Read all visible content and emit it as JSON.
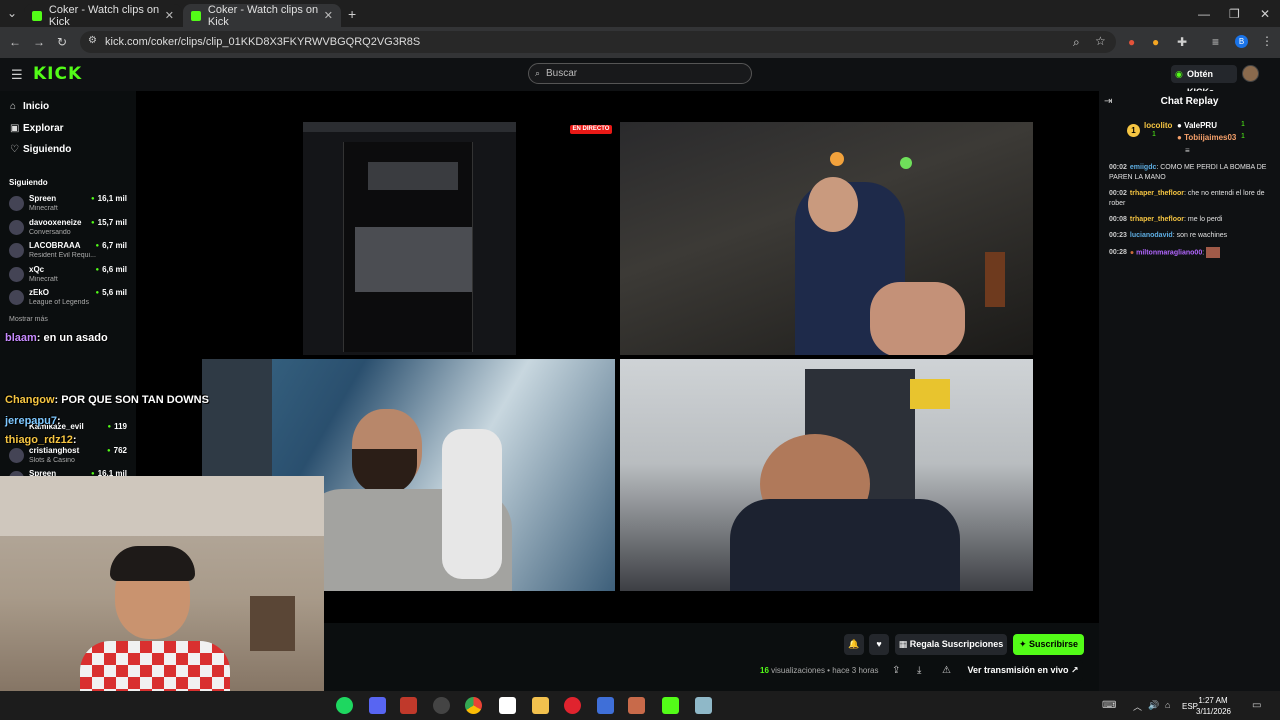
{
  "browser": {
    "tabs": [
      {
        "title": "Coker - Watch clips on Kick"
      },
      {
        "title": "Coker - Watch clips on Kick"
      }
    ],
    "url": "kick.com/coker/clips/clip_01KKD8X3FKYRWVBGQRQ2VG3R8S"
  },
  "kick": {
    "logo": "KICK",
    "search_placeholder": "Buscar",
    "get_kicks_label": "Obtén KICKs"
  },
  "sidebar": {
    "nav": [
      {
        "label": "Inicio",
        "icon": "home-icon"
      },
      {
        "label": "Explorar",
        "icon": "compass-icon"
      },
      {
        "label": "Siguiendo",
        "icon": "heart-icon"
      }
    ],
    "following_header": "Siguiendo",
    "following": [
      {
        "name": "Spreen",
        "category": "Minecraft",
        "viewers": "16,1 mil"
      },
      {
        "name": "davooxeneize",
        "category": "Conversando",
        "viewers": "15,7 mil"
      },
      {
        "name": "LACOBRAAA",
        "category": "Resident Evil Requi...",
        "viewers": "6,7 mil"
      },
      {
        "name": "xQc",
        "category": "Minecraft",
        "viewers": "6,6 mil"
      },
      {
        "name": "zEkO",
        "category": "League of Legends",
        "viewers": "5,6 mil"
      }
    ],
    "show_more": "Mostrar más",
    "recommended": [
      {
        "name": "Kamikaze_evil",
        "category": "",
        "viewers": "119"
      },
      {
        "name": "cristianghost",
        "category": "Slots & Casino",
        "viewers": "762"
      },
      {
        "name": "Spreen",
        "category": "",
        "viewers": "16,1 mil"
      }
    ]
  },
  "overlay_chat": [
    {
      "user": "blaam",
      "text": ": en un asado"
    },
    {
      "user": "Changow",
      "text": ": POR QUE SON TAN DOWNS"
    },
    {
      "user": "jerepapu7",
      "text": ":"
    },
    {
      "user": "thiago_rdz12",
      "text": ":"
    }
  ],
  "stream": {
    "live_badge": "EN DIRECTO"
  },
  "actions": {
    "gift_label": "Regala Suscripciones",
    "subscribe_label": "Suscribirse",
    "views_count": "16",
    "views_label": "visualizaciones",
    "time_ago": "hace 3 horas",
    "watch_live_label": "Ver transmisión en vivo"
  },
  "chat": {
    "title": "Chat Replay",
    "top_gifters": [
      {
        "name": "locolito",
        "count": "1"
      },
      {
        "name": "ValePRU",
        "count": "1"
      },
      {
        "name": "Tobiijaimes03",
        "count": "1"
      }
    ],
    "messages": [
      {
        "time": "00:02",
        "user": "emiigdc",
        "text": "COMO ME PERDI LA BOMBA DE PAREN LA MANO",
        "color": "#5dade2"
      },
      {
        "time": "00:02",
        "user": "trhaper_thefloor",
        "text": "che no entendi el lore de rober",
        "color": "#f5c542"
      },
      {
        "time": "00:08",
        "user": "trhaper_thefloor",
        "text": "me lo perdi",
        "color": "#f5c542"
      },
      {
        "time": "00:23",
        "user": "lucianodavid",
        "text": "son re wachines",
        "color": "#5dade2"
      },
      {
        "time": "00:28",
        "user": "miltonmaragliano00",
        "text": "",
        "color": "#b266ff"
      }
    ]
  },
  "taskbar": {
    "language": "ESP",
    "time": "1:27 AM",
    "date": "3/11/2026"
  }
}
